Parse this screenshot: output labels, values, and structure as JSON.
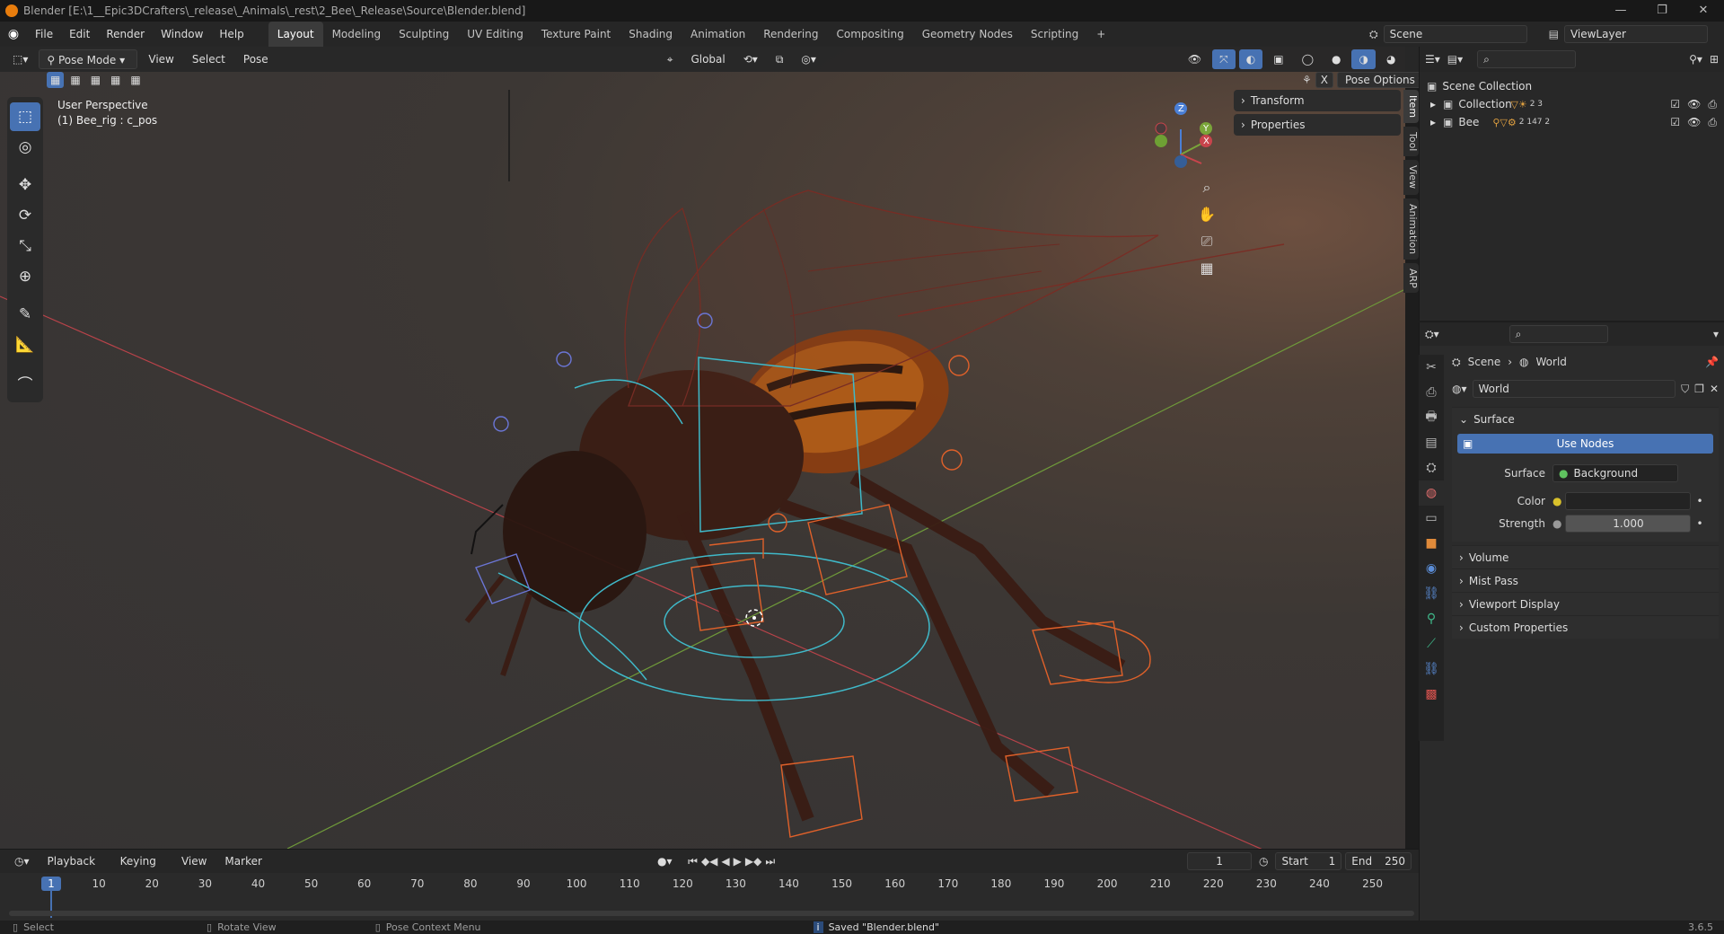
{
  "titlebar": {
    "title": "Blender [E:\\1__Epic3DCrafters\\_release\\_Animals\\_rest\\2_Bee\\_Release\\Source\\Blender.blend]"
  },
  "menubar": {
    "menus": [
      "File",
      "Edit",
      "Render",
      "Window",
      "Help"
    ],
    "workspaces": [
      "Layout",
      "Modeling",
      "Sculpting",
      "UV Editing",
      "Texture Paint",
      "Shading",
      "Animation",
      "Rendering",
      "Compositing",
      "Geometry Nodes",
      "Scripting"
    ],
    "active_workspace": "Layout",
    "add_tab": "+",
    "scene": "Scene",
    "view_layer": "ViewLayer"
  },
  "viewport_header": {
    "mode": "Pose Mode",
    "menus": [
      "View",
      "Select",
      "Pose"
    ],
    "transform_orientation": "Global",
    "pose_options": "Pose Options",
    "x_mirror": "X"
  },
  "viewport": {
    "view_name": "User Perspective",
    "object_info": "(1) Bee_rig : c_pos",
    "gizmo_axes": [
      "X",
      "Y",
      "Z"
    ]
  },
  "npanel": {
    "sections": [
      "Transform",
      "Properties"
    ],
    "tabs": [
      "Item",
      "Tool",
      "View",
      "Animation",
      "ARP"
    ]
  },
  "outliner": {
    "rows": [
      {
        "label": "Scene Collection",
        "level": 0
      },
      {
        "label": "Collection",
        "level": 1,
        "counts": "2 3"
      },
      {
        "label": "Bee",
        "level": 1,
        "counts": "2 147 2"
      }
    ]
  },
  "properties": {
    "breadcrumb": [
      "Scene",
      "World"
    ],
    "world_name": "World",
    "surface_section": "Surface",
    "use_nodes": "Use Nodes",
    "surface_label": "Surface",
    "surface_value": "Background",
    "color_label": "Color",
    "strength_label": "Strength",
    "strength_value": "1.000",
    "collapsed_sections": [
      "Volume",
      "Mist Pass",
      "Viewport Display",
      "Custom Properties"
    ]
  },
  "timeline": {
    "menus": [
      "Playback",
      "Keying",
      "View",
      "Marker"
    ],
    "current_frame": "1",
    "start_label": "Start",
    "start": "1",
    "end_label": "End",
    "end": "250",
    "ticks": [
      "1",
      "10",
      "20",
      "30",
      "40",
      "50",
      "60",
      "70",
      "80",
      "90",
      "100",
      "110",
      "120",
      "130",
      "140",
      "150",
      "160",
      "170",
      "180",
      "190",
      "200",
      "210",
      "220",
      "230",
      "240",
      "250"
    ]
  },
  "statusbar": {
    "select": "Select",
    "rotate": "Rotate View",
    "context": "Pose Context Menu",
    "message": "Saved \"Blender.blend\"",
    "version": "3.6.5"
  },
  "colors": {
    "accent": "#4772b3",
    "bone_orange": "#e0612a",
    "bone_cyan": "#3fb9c9",
    "bone_blue": "#6b76d6",
    "x_axis": "#c8444c",
    "y_axis": "#7aa53a"
  }
}
